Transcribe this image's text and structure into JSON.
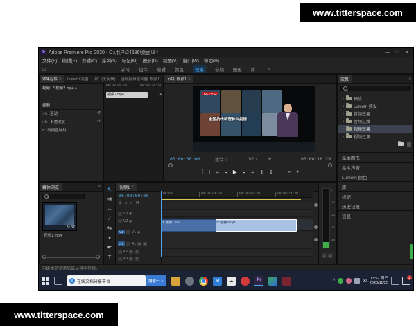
{
  "colors": {
    "accent_blue": "#2f7bd6",
    "timecode_blue": "#56a9e0",
    "workspace_active": "#4ea3e8",
    "clip_blue": "#4a6ea6",
    "clip_selected": "#a9c2e4",
    "work_area_yellow": "#d9c84e",
    "taskbar_bg": "#1b2234",
    "meter_green": "#3fae4a"
  },
  "watermark": {
    "text": "www.titterspace.com"
  },
  "window": {
    "title": "Adobe Premiere Pro 2020 - C:\\用户\\24686\\桌面\\3 *",
    "app_badge": "Pr",
    "minimize": "—",
    "maximize": "□",
    "close": "✕"
  },
  "menubar": {
    "items": [
      "文件(F)",
      "编辑(E)",
      "剪辑(C)",
      "序列(S)",
      "标记(M)",
      "图形(G)",
      "视图(V)",
      "窗口(W)",
      "帮助(H)"
    ]
  },
  "workspace": {
    "home": "⌂",
    "tabs": [
      "学习",
      "组件",
      "编辑",
      "颜色",
      "效果",
      "音频",
      "图形",
      "库"
    ],
    "overflow": "»"
  },
  "effect_controls": {
    "tabs": [
      "效果控件",
      "Lumetri 范围",
      "源：(无剪辑)",
      "音频剪辑混合器: 视频1"
    ],
    "menu_icon": "≡",
    "clip_label": "视频1 * 视频2.mp4",
    "expander": "▸",
    "collapse": "▴",
    "ruler": [
      "00:00:09:29",
      "00:00:14:29"
    ],
    "clip_bar": "视频2.mp4",
    "section": "视频",
    "rows": [
      {
        "chev": "›",
        "fx": "fx",
        "label": "运动",
        "reset": "↺"
      },
      {
        "chev": "›",
        "fx": "fx",
        "label": "不透明度",
        "reset": "↺"
      },
      {
        "chev": "",
        "fx": "fx",
        "label": "时间重映射",
        "reset": ""
      }
    ]
  },
  "program": {
    "tab": "节目: 视频1",
    "menu_icon": "≡",
    "video": {
      "badge": "CCTV-13",
      "overlay": "全国抗击新冠肺炎疫情"
    },
    "current_tc": "00:00:00:00",
    "fit": "适合",
    "dropdown": "∨",
    "resolution": "1/2",
    "wrench": "⚒",
    "total_tc": "00:00:16:29",
    "transport": [
      "{",
      "}",
      "⇤",
      "◂",
      "▶",
      "▸",
      "⇥",
      "↥",
      "↧"
    ],
    "more": "»",
    "plus": "+"
  },
  "effects_panel": {
    "tab": "效果",
    "menu_icon": "≡",
    "folders": [
      {
        "chev": "›",
        "label": "预设"
      },
      {
        "chev": "›",
        "label": "Lumetri 预设"
      },
      {
        "chev": "›",
        "label": "音频效果"
      },
      {
        "chev": "›",
        "label": "音频过渡"
      },
      {
        "chev": "›",
        "label": "视频效果"
      },
      {
        "chev": "›",
        "label": "视频过渡"
      }
    ],
    "panels": [
      "基本图形",
      "基本声音",
      "Lumetri 颜色",
      "库",
      "标记",
      "历史记录",
      "信息"
    ]
  },
  "project": {
    "tab": "媒体浏览",
    "overflow": "»",
    "clip_name": "视频1.mp4",
    "thumb_duration": "6:07"
  },
  "tools": {
    "items": [
      "↖",
      "⇉",
      "↔",
      "∕",
      "⇆",
      "♦",
      "☛",
      "T"
    ]
  },
  "timeline": {
    "tab": "视频1",
    "menu_icon": "≡",
    "tc": "00:00:00:00",
    "toolbar": [
      "⊕",
      "∪",
      "∞",
      "⚒"
    ],
    "ruler": [
      "00:00",
      "00:00:04:29",
      "00:00:09:29",
      "00:00:14:29"
    ],
    "video_tracks": [
      "V3",
      "V2",
      "V1"
    ],
    "audio_tracks": [
      "A1",
      "A2",
      "A3"
    ],
    "mute": "M",
    "solo": "S",
    "eye": "◉",
    "clips": [
      {
        "fx": "fx",
        "name": "视频1.mp4"
      },
      {
        "fx": "fx",
        "name": "视频2.mp4"
      }
    ]
  },
  "audio_meters": {
    "labels": [
      "0",
      "-12",
      "-24",
      "-36",
      "-48"
    ],
    "solo_left": "S",
    "solo_right": "S"
  },
  "statusbar": {
    "hint": "向媒体浏览添加或从其中拖拽。"
  },
  "taskbar": {
    "search_engine": "e",
    "search_text": "在线文档分享平台",
    "search_button": "搜索一下",
    "premiere_label": "Pr",
    "tray_expand": "^",
    "clock_time": "13:52 周三",
    "clock_date": "2020/11/25",
    "notification_count": "1"
  }
}
